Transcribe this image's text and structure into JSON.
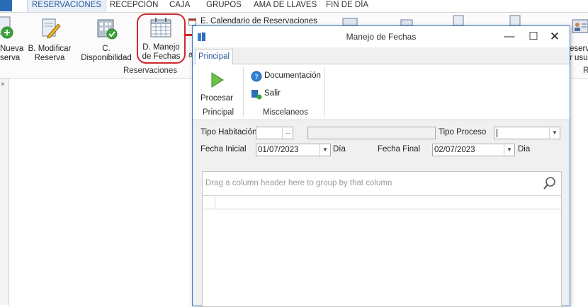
{
  "menu": {
    "items": [
      "RESERVACIONES",
      "RECEPCIÓN",
      "CAJA",
      "GRUPOS",
      "AMA DE LLAVES",
      "FIN DE DÍA"
    ]
  },
  "ribbon": {
    "nueva_line1": "Nueva",
    "nueva_line2": "serva",
    "modificar_line1": "B. Modificar",
    "modificar_line2": "Reserva",
    "disponibilidad": "C. Disponibilidad",
    "manejo_line1": "D. Manejo",
    "manejo_line2": "de Fechas",
    "calendario": "E. Calendario de Reservaciones",
    "group_label": "Reservaciones",
    "partial_a": "a",
    "right_partial_line1": "eserva",
    "right_partial_line2": "r usu",
    "right_partial_group": "R"
  },
  "window": {
    "title": "Manejo de Fechas",
    "tab": "Principal",
    "procesar": "Procesar",
    "principal_group": "Principal",
    "documentacion": "Documentación",
    "salir": "Salir",
    "misc_group": "Miscelaneos"
  },
  "form": {
    "tipo_habitacion_label": "Tipo Habitación",
    "tipo_habitacion_value": "",
    "tipo_habitacion_ellipsis": "···",
    "tipo_proceso_label": "Tipo Proceso",
    "fecha_inicial_label": "Fecha Inicial",
    "fecha_inicial_value": "01/07/2023",
    "dia1": "Día",
    "fecha_final_label": "Fecha Final",
    "fecha_final_value": "02/07/2023",
    "dia2": "Dia"
  },
  "grid": {
    "group_hint": "Drag a column header here to group by that column"
  },
  "colors": {
    "accent": "#2b5797",
    "window_border": "#3c7fcf",
    "highlight_circle": "#d0282e"
  }
}
